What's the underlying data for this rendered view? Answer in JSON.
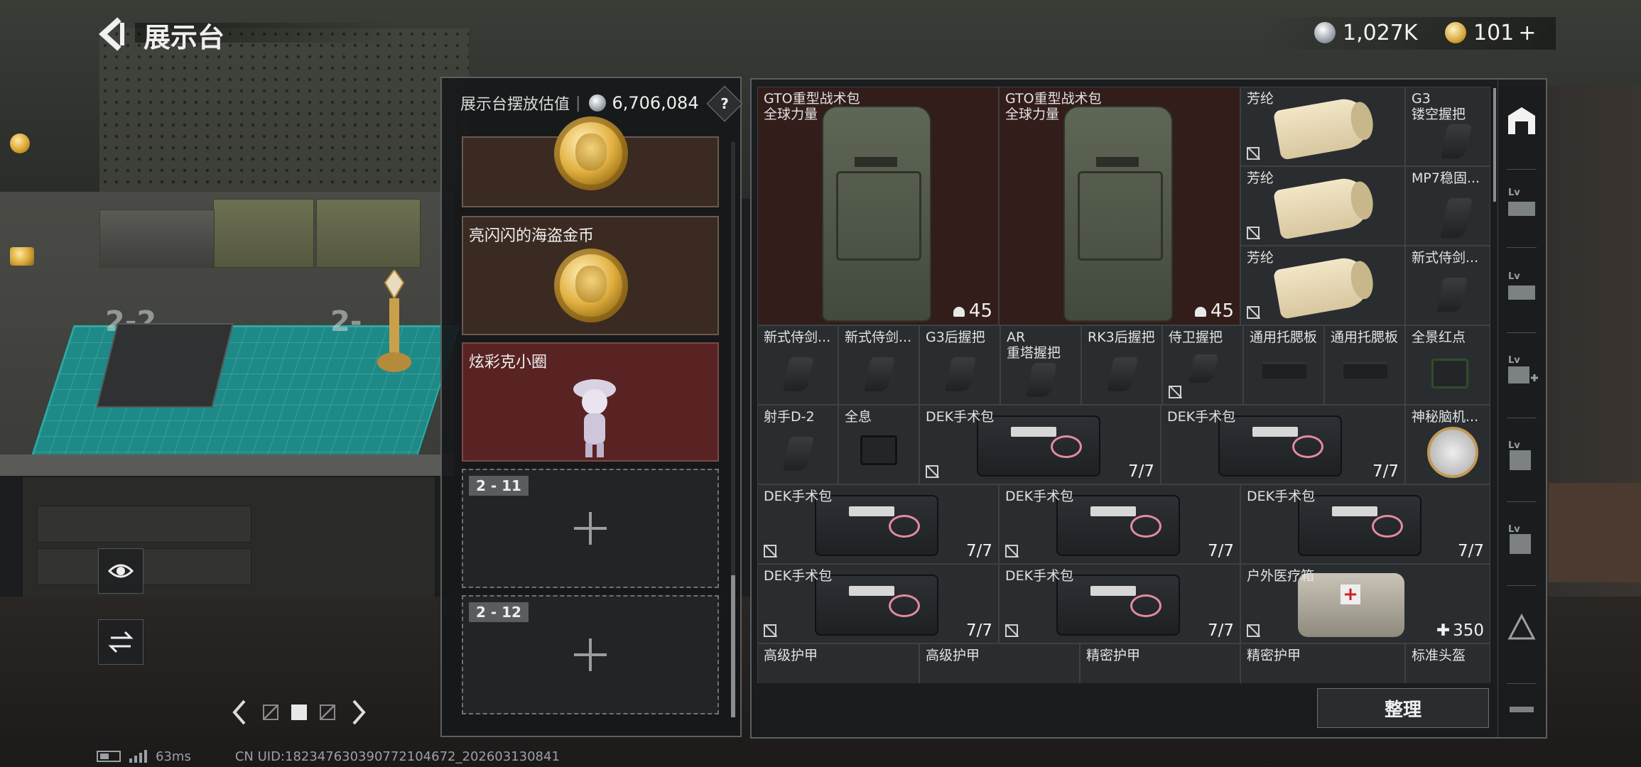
{
  "header": {
    "title": "展示台"
  },
  "currency": {
    "silver": "1,027K",
    "gold": "101",
    "gold_add": "+"
  },
  "scene": {
    "mat_labels": [
      "2-2",
      "2-"
    ]
  },
  "display_panel": {
    "value_label": "展示台摆放估值",
    "value": "6,706,084",
    "help": "?",
    "slots": [
      {
        "name": ""
      },
      {
        "name": "亮闪闪的海盗金币"
      },
      {
        "name": "炫彩克小圈"
      },
      {
        "tag": "2 - 11"
      },
      {
        "tag": "2 - 12"
      }
    ]
  },
  "pager": {
    "pages": 3,
    "active": 2
  },
  "status": {
    "ping": "63ms",
    "uid": "CN UID:182347630390772104672_202603130841"
  },
  "inventory": {
    "items": [
      {
        "label": "GTO重型战术包\n全球力量",
        "count": "45"
      },
      {
        "label": "GTO重型战术包\n全球力量",
        "count": "45"
      },
      {
        "label": "芳纶"
      },
      {
        "label": "G3\n镂空握把"
      },
      {
        "label": "芳纶"
      },
      {
        "label": "MP7稳固..."
      },
      {
        "label": "芳纶"
      },
      {
        "label": "新式侍剑..."
      },
      {
        "label": "新式侍剑..."
      },
      {
        "label": "新式侍剑..."
      },
      {
        "label": "G3后握把"
      },
      {
        "label": "AR\n重塔握把"
      },
      {
        "label": "RK3后握把"
      },
      {
        "label": "侍卫握把"
      },
      {
        "label": "通用托腮板"
      },
      {
        "label": "通用托腮板"
      },
      {
        "label": "全景红点"
      },
      {
        "label": "射手D-2"
      },
      {
        "label": "全息"
      },
      {
        "label": "DEK手术包",
        "count": "7/7"
      },
      {
        "label": "DEK手术包",
        "count": "7/7"
      },
      {
        "label": "神秘脑机..."
      },
      {
        "label": "DEK手术包",
        "count": "7/7"
      },
      {
        "label": "DEK手术包",
        "count": "7/7"
      },
      {
        "label": "DEK手术包",
        "count": "7/7"
      },
      {
        "label": "DEK手术包",
        "count": "7/7"
      },
      {
        "label": "DEK手术包",
        "count": "7/7"
      },
      {
        "label": "户外医疗箱",
        "count": "350"
      },
      {
        "label": "高级护甲"
      },
      {
        "label": "高级护甲"
      },
      {
        "label": "精密护甲"
      },
      {
        "label": "精密护甲"
      },
      {
        "label": "标准头盔"
      }
    ],
    "sort_label": "整理",
    "tab_level": "Lv"
  },
  "icons": [
    "back-arrow-icon",
    "silver-coin-icon",
    "gold-coin-icon",
    "eye-icon",
    "swap-icon",
    "help-icon",
    "no-drop-icon",
    "helmet-icon",
    "plus-icon",
    "warehouse-tab-icon"
  ]
}
